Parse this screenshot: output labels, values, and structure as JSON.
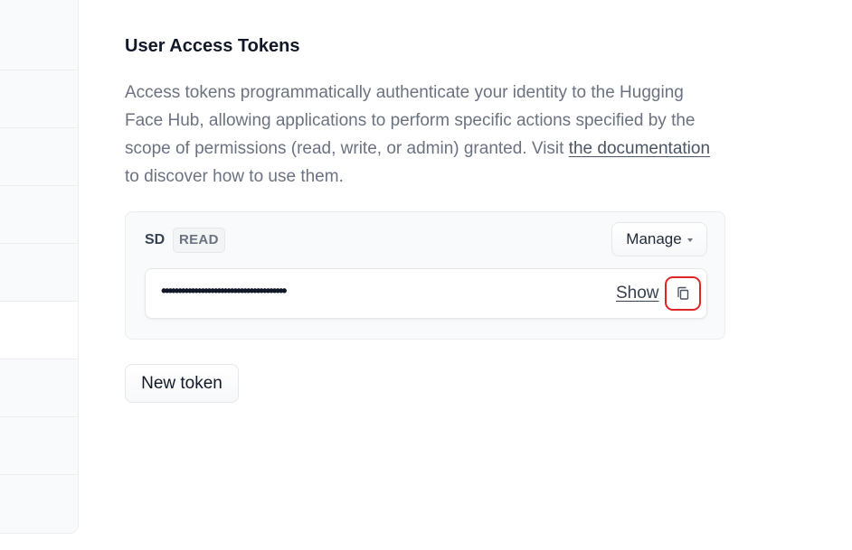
{
  "page": {
    "title": "User Access Tokens",
    "description_part1": "Access tokens programmatically authenticate your identity to the Hugging Face Hub, allowing applications to perform specific actions specified by the scope of permissions (read, write, or admin) granted. Visit ",
    "documentation_link": "the documentation",
    "description_part2": " to discover how to use them."
  },
  "token": {
    "name": "SD",
    "role": "READ",
    "manage_label": "Manage",
    "masked_value": "••••••••••••••••••••••••••••••••••••••",
    "show_label": "Show",
    "copy_icon": "copy-icon"
  },
  "actions": {
    "new_token_label": "New token"
  },
  "colors": {
    "copy_highlight": "#dc2626",
    "card_background": "#f9fafb"
  }
}
